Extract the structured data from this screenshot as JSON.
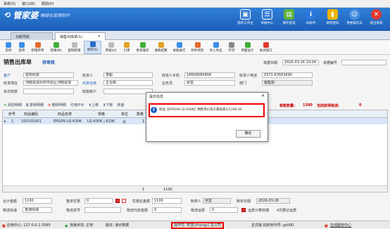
{
  "menu": [
    "系统(S)",
    "窗口(W)",
    "帮助(H)"
  ],
  "app": {
    "logo": "管家婆",
    "slogan": "精细化管理软件"
  },
  "header_icons": [
    {
      "label": "我的工作台",
      "icon": "desk-icon",
      "color": "#3a7fd6"
    },
    {
      "label": "单据中心",
      "icon": "doc-center-icon",
      "color": "#3a7fd6"
    },
    {
      "label": "库存查询",
      "icon": "stock-icon",
      "color": "#5db33c"
    },
    {
      "label": "ID助手",
      "icon": "info-icon",
      "color": "#2b78e0"
    },
    {
      "label": "修改密码",
      "icon": "lock-icon",
      "color": "#f0b300"
    },
    {
      "label": "更换操作员",
      "icon": "user-icon",
      "color": "#4a90e2"
    },
    {
      "label": "退出系统",
      "icon": "exit-icon",
      "color": "#e03a2e"
    }
  ],
  "tabs": [
    "功能导航",
    "销售出库单(1)"
  ],
  "toolbar": [
    "前单",
    "后单",
    "新增开单",
    "新增(N)",
    "复制新增",
    "保存(S)",
    "审核(U)",
    "引用",
    "更多操作",
    "收款结算",
    "关联发打",
    "附件资料",
    "导入导出",
    "打印",
    "界面设计",
    "关闭窗口"
  ],
  "doc": {
    "title": "销售出库单",
    "status": "待审核",
    "date_label": "单据日期",
    "date": "2026-03-26 10:04",
    "no_label": "单据编号"
  },
  "form": {
    "customer_label": "客户",
    "customer": "亚邦科技",
    "recv_person_label": "收货人",
    "recv_person": "李超",
    "recv_phone_label": "收货人手机",
    "recv_phone": "18608080808",
    "recv_tel_label": "收货人电话",
    "recv_tel": "0371-63563890",
    "addr_label": "收货地址",
    "addr": "河南省郑州市中原区河南省郑",
    "warehouse_label": "出货仓库",
    "warehouse": "主仓库",
    "salesman_label": "业务员",
    "salesman": "张亚",
    "dept_label": "部门",
    "dept": "销售部",
    "income_label": "本次收款",
    "account_label": "收款账户"
  },
  "grid_toolbar": {
    "items": [
      "添加明细",
      "复制明细",
      "删除明细",
      "引用(F4)",
      "上移",
      "下移",
      "快速"
    ],
    "sum_label": "销售数量:",
    "sum": "1300",
    "error_label": "当前获得错误:",
    "error": "0"
  },
  "grid": {
    "headers": [
      "序号",
      "商品编码",
      "商品名称",
      "规格",
      "单位",
      "数量"
    ],
    "row": [
      "1",
      "100101001",
      "EPSON LQ-630K",
      "LQ-630K | 620K",
      "台",
      "1"
    ],
    "total": "1",
    "total2": "1100"
  },
  "dialog": {
    "title": "提示信息",
    "message": "商品【EPSON LQ-630K】销售单价低于最低售价1200.00",
    "button": "确定"
  },
  "footer": {
    "total_label": "合计金额",
    "total": "1100",
    "discount_label": "整单优惠",
    "discount": "0",
    "after_label": "优惠后金额",
    "after": "1100",
    "maker_label": "制单人",
    "maker": "张亚",
    "audit_date_label": "制单日期",
    "audit_date": "2026-03-26",
    "ship_label": "物流快递",
    "ship": "普通快递",
    "ship_no_label": "物流单号",
    "ship_fee_label": "物流代收金额",
    "ship_fee": "0",
    "ship_amt_label": "物流运费",
    "ship_amt": "0",
    "ship_check_label": "运费计算快捷",
    "pay_label": "4次要记运费"
  },
  "statusbar": {
    "server": "应用中心: 127.0.0.1:7095",
    "conn": "连接状态: 正常",
    "version": "版本: 演示数据",
    "operator": "操作员: 牧亚(zhangy) 总公司",
    "edition": "正式版 授权序列号: gs000",
    "help": "在线服务中心"
  }
}
